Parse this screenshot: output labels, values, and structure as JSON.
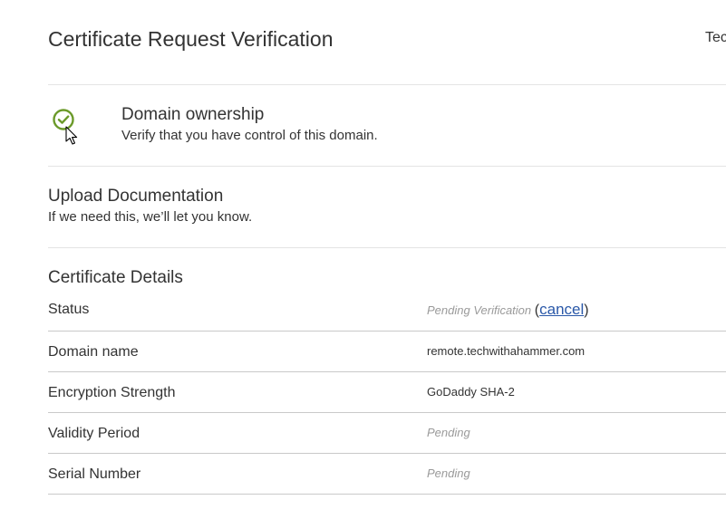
{
  "header": {
    "title": "Certificate Request Verification",
    "account_label": "Tec"
  },
  "steps": [
    {
      "title": "Domain ownership",
      "description": "Verify that you have control of this domain.",
      "icon": "check-circle-icon",
      "icon_color": "#6b9a2a",
      "completed": true
    },
    {
      "title": "Upload Documentation",
      "description": "If we need this, we’ll let you know."
    }
  ],
  "details": {
    "title": "Certificate Details",
    "status": {
      "label": "Status",
      "value": "Pending Verification",
      "open_paren": "(",
      "cancel_label": "cancel",
      "close_paren": ")"
    },
    "rows": [
      {
        "label": "Domain name",
        "value": "remote.techwithahammer.com",
        "pending": false
      },
      {
        "label": "Encryption Strength",
        "value": "GoDaddy SHA-2",
        "pending": false
      },
      {
        "label": "Validity Period",
        "value": "Pending",
        "pending": true
      },
      {
        "label": "Serial Number",
        "value": "Pending",
        "pending": true
      }
    ]
  },
  "colors": {
    "link": "#2a58a8",
    "pending_text": "#9a9a9a",
    "divider": "#e4e4e4"
  }
}
